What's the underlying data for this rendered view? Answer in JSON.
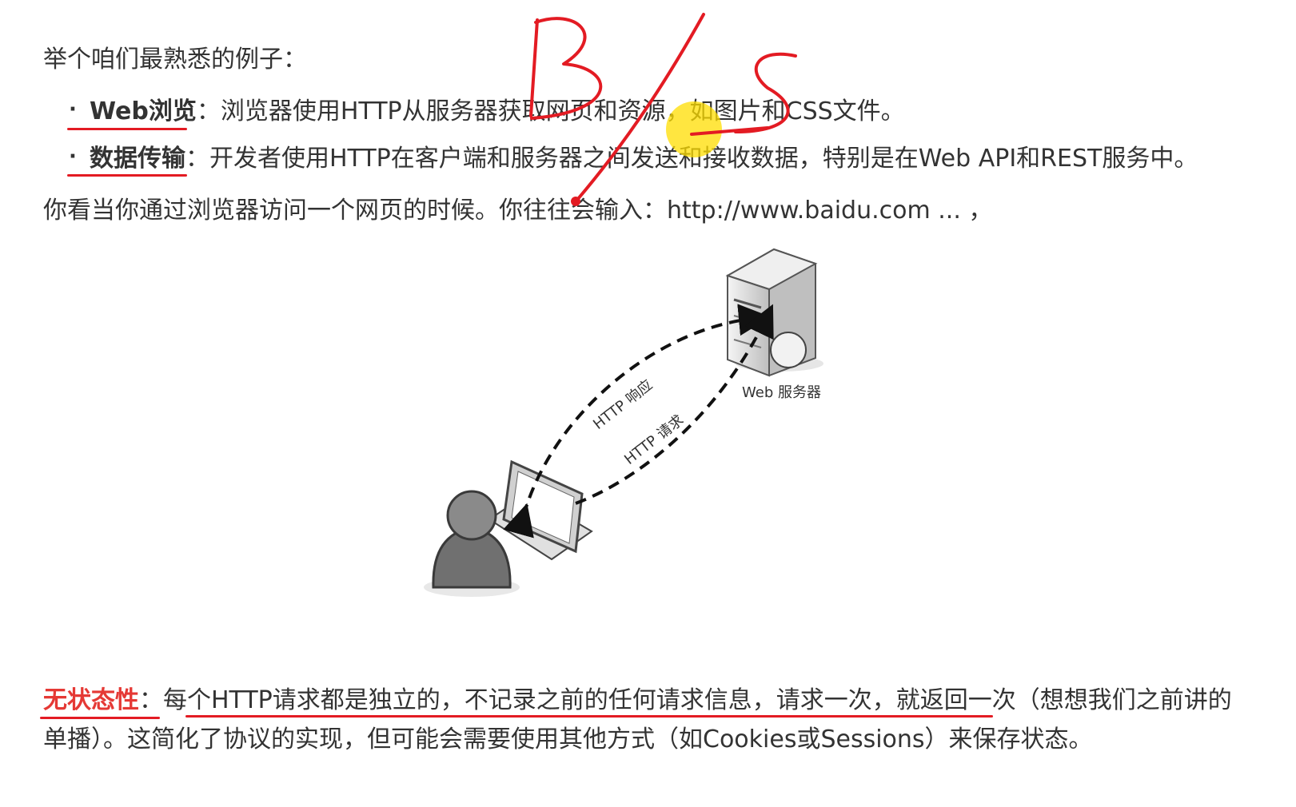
{
  "intro": "举个咱们最熟悉的例子：",
  "bullets": [
    {
      "term": "Web浏览",
      "sep": "：",
      "text": "浏览器使用HTTP从服务器获取网页和资源，如图片和CSS文件。"
    },
    {
      "term": "数据传输",
      "sep": "：",
      "text": "开发者使用HTTP在客户端和服务器之间发送和接收数据，特别是在Web API和REST服务中。"
    }
  ],
  "browse_line": "你看当你通过浏览器访问一个网页的时候。你往往会输入：http://www.baidu.com ... ，",
  "diagram": {
    "server_label": "Web 服务器",
    "response_label": "HTTP 响应",
    "request_label": "HTTP 请求"
  },
  "annotation": {
    "handwriting": "B/S"
  },
  "stateless": {
    "term": "无状态性",
    "sep": "：",
    "line1": "每个HTTP请求都是独立的，不记录之前的任何请求信息，请求一次，就返回一次（想想我们之前讲的",
    "line2": "单播）。这简化了协议的实现，但可能会需要使用其他方式（如Cookies或Sessions）来保存状态。"
  },
  "colors": {
    "annotation_red": "#e31b23",
    "term_red": "#e53935",
    "highlight": "#ffdd00"
  }
}
